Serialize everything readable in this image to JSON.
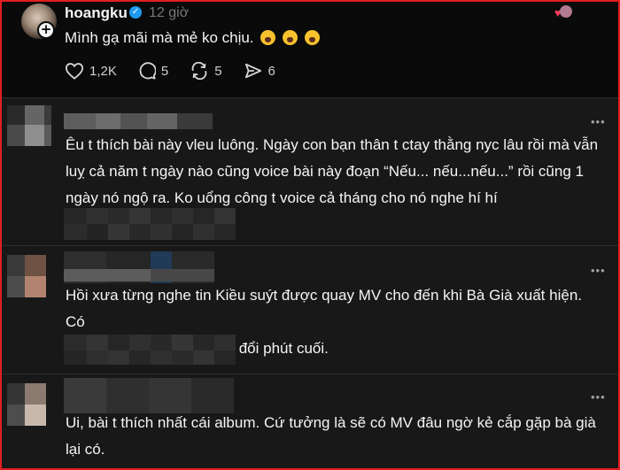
{
  "post": {
    "username": "hoangku",
    "time": "12 giờ",
    "text": "Mình gạ mãi mà mẻ ko chịu.",
    "emojis": [
      "crying-face",
      "crying-face",
      "crying-face"
    ],
    "likes": "1,2K",
    "comments": "5",
    "reposts": "5",
    "shares": "6"
  },
  "replies": [
    {
      "line1": "Êu t thích bài này vleu luông. Ngày con bạn thân t ctay thằng nyc lâu rồi mà vẫn",
      "line2": "luỵ cả năm t ngày nào cũng voice bài này đoạn “Nếu... nếu...nếu...” rồi cũng 1",
      "line3": "ngày nó ngộ ra. Ko uổng công t voice cả tháng cho nó nghe hí hí"
    },
    {
      "line1": "Hồi xưa từng nghe tin Kiều suýt được quay MV cho đến khi Bà Già xuất hiện. Có",
      "line2": "thể là dự tính nhưng thay đổi phút cuối."
    },
    {
      "line1": "Ui, bài t thích nhất cái album. Cứ tưởng là sẽ có MV đâu ngờ kẻ cắp gặp bà già",
      "line2": "lại có."
    }
  ],
  "colors": {
    "frame_border": "#e01e1e",
    "background": "#101010",
    "reply_background": "#181818",
    "text": "#f3f5f7",
    "muted": "#777777",
    "verified": "#1d9bf0"
  }
}
